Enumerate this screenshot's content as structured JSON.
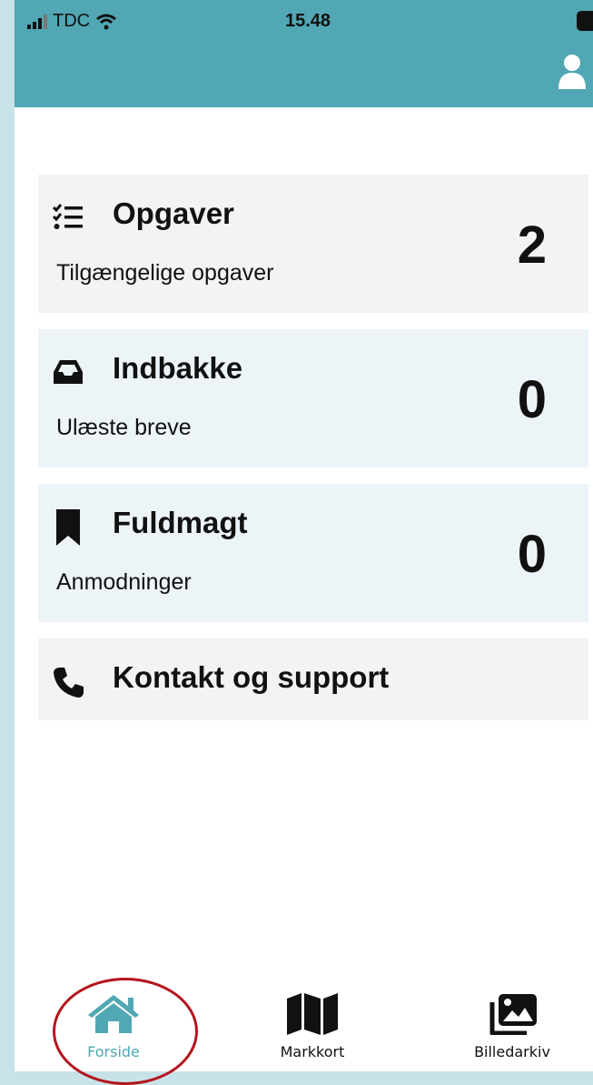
{
  "status_bar": {
    "carrier": "TDC",
    "time": "15.48"
  },
  "cards": [
    {
      "title": "Opgaver",
      "subtitle": "Tilgængelige opgaver",
      "count": "2",
      "icon": "task-list-icon"
    },
    {
      "title": "Indbakke",
      "subtitle": "Ulæste breve",
      "count": "0",
      "icon": "inbox-icon"
    },
    {
      "title": "Fuldmagt",
      "subtitle": "Anmodninger",
      "count": "0",
      "icon": "bookmark-icon"
    },
    {
      "title": "Kontakt og support",
      "icon": "phone-icon"
    }
  ],
  "bottom_nav": [
    {
      "label": "Forside",
      "icon": "home-icon",
      "active": true
    },
    {
      "label": "Markkort",
      "icon": "map-icon",
      "active": false
    },
    {
      "label": "Billedarkiv",
      "icon": "images-icon",
      "active": false
    }
  ],
  "colors": {
    "header": "#51a7b4",
    "active_nav": "#51a7b4",
    "annotation_circle": "#b3151d"
  }
}
